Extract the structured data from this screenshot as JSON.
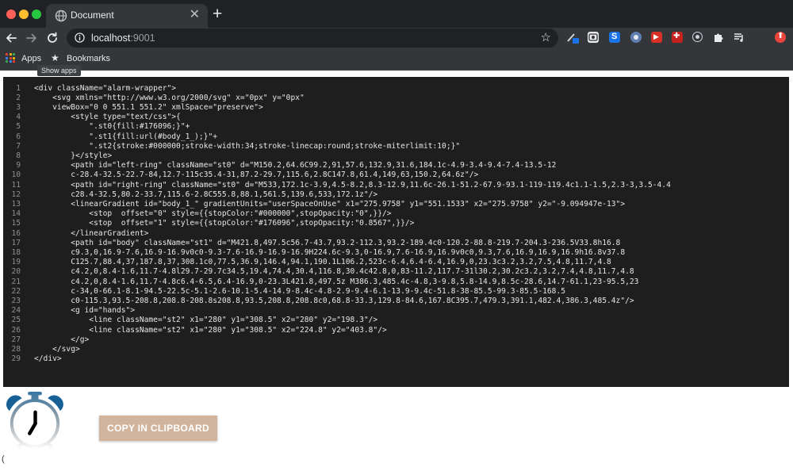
{
  "browser": {
    "tab_title": "Document",
    "tab_close": "✕",
    "new_tab": "+",
    "url_host": "localhost",
    "url_port": ":9001"
  },
  "bookmarks": {
    "apps_label": "Apps",
    "bookmarks_label": "Bookmarks",
    "tooltip": "Show apps"
  },
  "code": {
    "lines": [
      "<div className=\"alarm-wrapper\">",
      "    <svg xmlns=\"http://www.w3.org/2000/svg\" x=\"0px\" y=\"0px\"",
      "    viewBox=\"0 0 551.1 551.2\" xmlSpace=\"preserve\">",
      "        <style type=\"text/css\">{",
      "            \".st0{fill:#176096;}\"+",
      "            \".st1{fill:url(#body_1_);}\"+",
      "            \".st2{stroke:#000000;stroke-width:34;stroke-linecap:round;stroke-miterlimit:10;}\"",
      "        }</style>",
      "        <path id=\"left-ring\" className=\"st0\" d=\"M150.2,64.6C99.2,91,57.6,132.9,31.6,184.1c-4.9-3.4-9.4-7.4-13.5-12",
      "        c-28.4-32.5-22.7-84,12.7-115c35.4-31,87.2-29.7,115.6,2.8C147.8,61.4,149,63,150.2,64.6z\"/>",
      "        <path id=\"right-ring\" className=\"st0\" d=\"M533,172.1c-3.9,4.5-8.2,8.3-12.9,11.6c-26.1-51.2-67.9-93.1-119-119.4c1.1-1.5,2.3-3,3.5-4.4",
      "        c28.4-32.5,80.2-33.7,115.6-2.8C555.8,88.1,561.5,139.6,533,172.1z\"/>",
      "        <linearGradient id=\"body_1_\" gradientUnits=\"userSpaceOnUse\" x1=\"275.9758\" y1=\"551.1533\" x2=\"275.9758\" y2=\"-9.094947e-13\">",
      "            <stop  offset=\"0\" style={{stopColor:\"#000000\",stopOpacity:\"0\",}}/>",
      "            <stop  offset=\"1\" style={{stopColor:\"#176096\",stopOpacity:\"0.8567\",}}/>",
      "        </linearGradient>",
      "        <path id=\"body\" className=\"st1\" d=\"M421.8,497.5c56.7-43.7,93.2-112.3,93.2-189.4c0-120.2-88.8-219.7-204.3-236.5V33.8h16.8",
      "        c9.3,0,16.9-7.6,16.9-16.9v0c0-9.3-7.6-16.9-16.9-16.9H224.6c-9.3,0-16.9,7.6-16.9,16.9v0c0,9.3,7.6,16.9,16.9,16.9h16.8v37.8",
      "        C125.7,88.4,37,187.8,37,308.1c0,77.5,36.9,146.4,94.1,190.1L106.2,523c-6.4,6.4-6.4,16.9,0,23.3c3.2,3.2,7.5,4.8,11.7,4.8",
      "        c4.2,0,8.4-1.6,11.7-4.8l29.7-29.7c34.5,19.4,74.4,30.4,116.8,30.4c42.8,0,83-11.2,117.7-31l30.2,30.2c3.2,3.2,7.4,4.8,11.7,4.8",
      "        c4.2,0,8.4-1.6,11.7-4.8c6.4-6.5,6.4-16.9,0-23.3L421.8,497.5z M386.3,485.4c-4.8,3-9.8,5.8-14.9,8.5c-28.6,14.7-61.1,23-95.5,23",
      "        c-34,0-66.1-8.1-94.5-22.5c-5.1-2.6-10.1-5.4-14.9-8.4c-4.8-2.9-9.4-6.1-13.9-9.4c-51.8-38-85.5-99.3-85.5-168.5",
      "        c0-115.3,93.5-208.8,208.8-208.8s208.8,93.5,208.8,208.8c0,68.8-33.3,129.8-84.6,167.8C395.7,479.3,391.1,482.4,386.3,485.4z\"/>",
      "        <g id=\"hands\">",
      "            <line className=\"st2\" x1=\"280\" y1=\"308.5\" x2=\"280\" y2=\"198.3\"/>",
      "            <line className=\"st2\" x1=\"280\" y1=\"308.5\" x2=\"224.8\" y2=\"403.8\"/>",
      "        </g>",
      "    </svg>",
      "</div>"
    ]
  },
  "page": {
    "copy_button_label": "COPY IN CLIPBOARD",
    "stray_char": "("
  },
  "icons": {
    "clock": "alarm-clock-icon",
    "globe": "globe-icon",
    "info": "info-icon",
    "star": "star-icon"
  },
  "colors": {
    "clock_blue": "#176096",
    "button_bg": "#d1b49d",
    "code_bg": "#1e1e1e",
    "chrome_dark": "#202124",
    "chrome_toolbar": "#35363a"
  }
}
